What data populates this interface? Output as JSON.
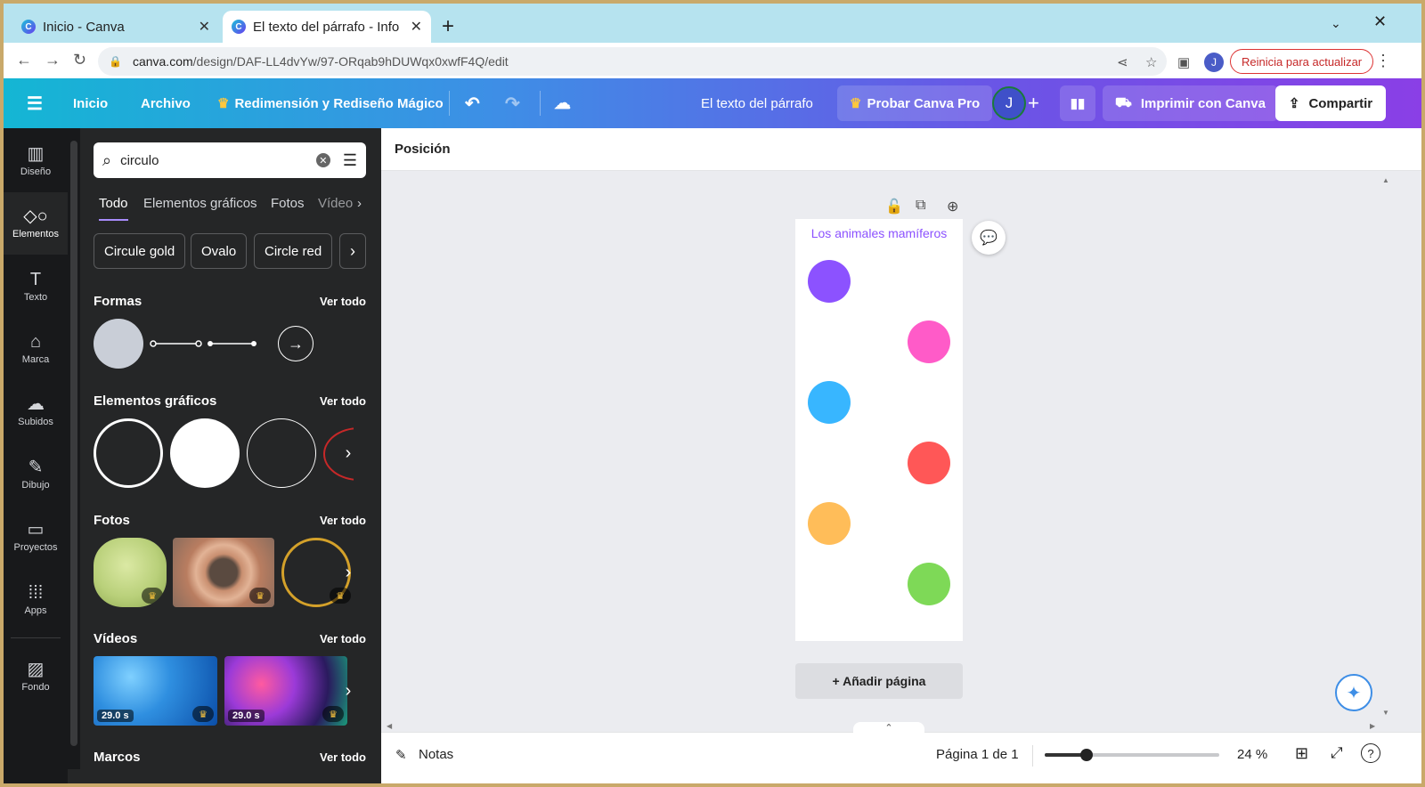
{
  "browser": {
    "tabs": [
      {
        "title": "Inicio - Canva",
        "active": false
      },
      {
        "title": "El texto del párrafo - Info",
        "active": true
      }
    ],
    "new_tab_icon": "plus-icon",
    "url_domain": "canva.com",
    "url_path": "/design/DAF-LL4dvYw/97-ORqab9hDUWqx0xwfF4Q/edit",
    "profile_initial": "J",
    "update_label": "Reinicia para actualizar",
    "colors": {
      "tabstrip": "#b6e3ef",
      "update": "#c62828"
    }
  },
  "header": {
    "inicio": "Inicio",
    "archivo": "Archivo",
    "magic_resize": "Redimensión y Rediseño Mágico",
    "doc_title": "El texto del párrafo",
    "try_pro": "Probar Canva Pro",
    "avatar_initial": "J",
    "print": "Imprimir con Canva",
    "share": "Compartir"
  },
  "rail": {
    "items": [
      {
        "label": "Diseño",
        "icon": "layout-icon"
      },
      {
        "label": "Elementos",
        "icon": "shapes-icon"
      },
      {
        "label": "Texto",
        "icon": "text-icon"
      },
      {
        "label": "Marca",
        "icon": "brand-icon"
      },
      {
        "label": "Subidos",
        "icon": "upload-cloud-icon"
      },
      {
        "label": "Dibujo",
        "icon": "pen-icon"
      },
      {
        "label": "Proyectos",
        "icon": "folder-icon"
      },
      {
        "label": "Apps",
        "icon": "grid-icon"
      },
      {
        "label": "Fondo",
        "icon": "background-icon"
      }
    ]
  },
  "panel": {
    "search_value": "circulo",
    "tabs": [
      "Todo",
      "Elementos gráficos",
      "Fotos",
      "Vídeo"
    ],
    "chips": [
      "Circule gold",
      "Ovalo",
      "Circle red"
    ],
    "see_all": "Ver todo",
    "sections": {
      "formas": "Formas",
      "graficos": "Elementos gráficos",
      "fotos": "Fotos",
      "videos": "Vídeos",
      "marcos": "Marcos"
    },
    "videos": [
      {
        "duration": "29.0 s"
      },
      {
        "duration": "29.0 s"
      }
    ]
  },
  "toolbar": {
    "position_label": "Posición"
  },
  "canvas": {
    "page_title": "Los animales mamíferos",
    "dots": [
      {
        "color": "#8c52ff"
      },
      {
        "color": "#ff5bc8"
      },
      {
        "color": "#38b6ff"
      },
      {
        "color": "#ff5757"
      },
      {
        "color": "#ffbd59"
      },
      {
        "color": "#7ed957"
      }
    ],
    "add_page": "+ Añadir página"
  },
  "footer": {
    "notes": "Notas",
    "page_indicator": "Página 1 de 1",
    "zoom_value": 24,
    "zoom_label": "24 %"
  }
}
